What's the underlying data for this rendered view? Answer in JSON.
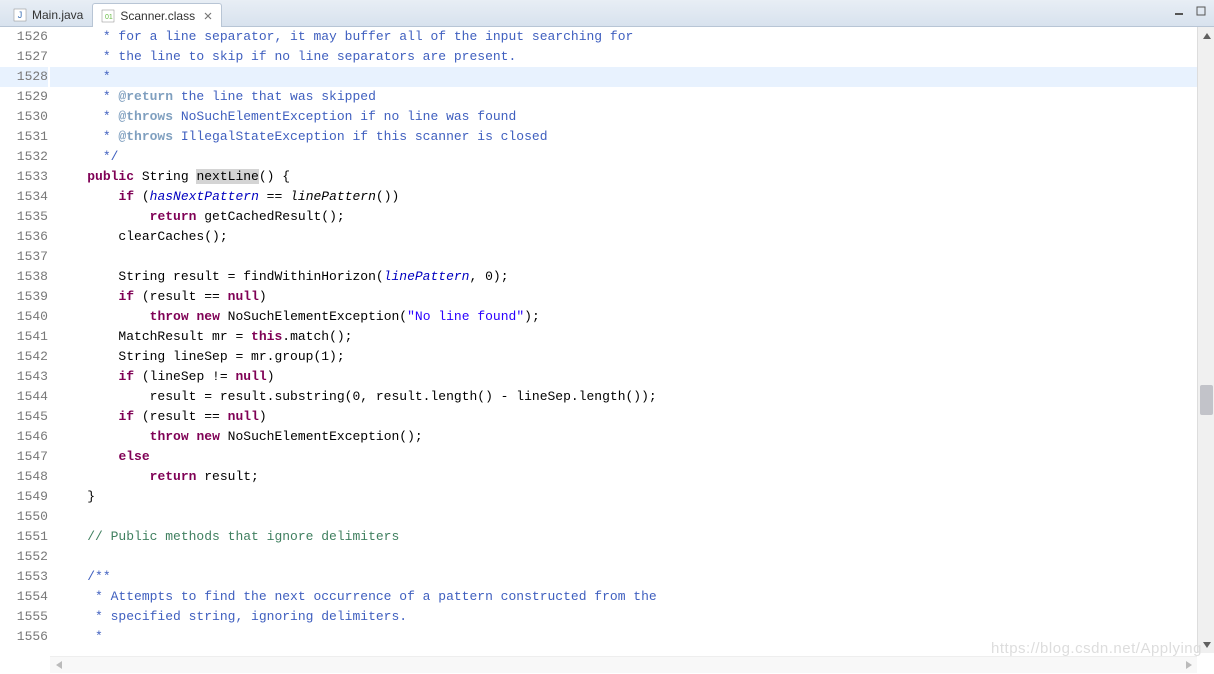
{
  "tabs": {
    "inactive": {
      "label": "Main.java"
    },
    "active": {
      "label": "Scanner.class"
    }
  },
  "gutter": {
    "start": 1526,
    "end": 1556
  },
  "highlightLine": 1528,
  "code": {
    "l1526": " * for a line separator, it may buffer all of the input searching for",
    "l1527": " * the line to skip if no line separators are present.",
    "l1528": " *",
    "l1529_prefix": " * ",
    "l1529_tag": "@return",
    "l1529_rest": " the line that was skipped",
    "l1530_prefix": " * ",
    "l1530_tag": "@throws",
    "l1530_rest": " NoSuchElementException if no line was found",
    "l1531_prefix": " * ",
    "l1531_tag": "@throws",
    "l1531_rest": " IllegalStateException if this scanner is closed",
    "l1532": " */",
    "l1533_kw": "public",
    "l1533_type": " String ",
    "l1533_name": "nextLine",
    "l1533_rest": "() {",
    "l1534_pre": "    ",
    "l1534_kw": "if",
    "l1534_mid": " (",
    "l1534_field": "hasNextPattern",
    "l1534_mid2": " == ",
    "l1534_call": "linePattern",
    "l1534_rest": "())",
    "l1535_pre": "        ",
    "l1535_kw": "return",
    "l1535_rest": " getCachedResult();",
    "l1536": "    clearCaches();",
    "l1538_pre": "    String result = findWithinHorizon(",
    "l1538_field": "linePattern",
    "l1538_rest": ", 0);",
    "l1539_pre": "    ",
    "l1539_kw": "if",
    "l1539_mid": " (result == ",
    "l1539_kw2": "null",
    "l1539_rest": ")",
    "l1540_pre": "        ",
    "l1540_kw1": "throw",
    "l1540_sp": " ",
    "l1540_kw2": "new",
    "l1540_mid": " NoSuchElementException(",
    "l1540_str": "\"No line found\"",
    "l1540_rest": ");",
    "l1541_pre": "    MatchResult mr = ",
    "l1541_kw": "this",
    "l1541_rest": ".match();",
    "l1542": "    String lineSep = mr.group(1);",
    "l1543_pre": "    ",
    "l1543_kw": "if",
    "l1543_mid": " (lineSep != ",
    "l1543_kw2": "null",
    "l1543_rest": ")",
    "l1544": "        result = result.substring(0, result.length() - lineSep.length());",
    "l1545_pre": "    ",
    "l1545_kw": "if",
    "l1545_mid": " (result == ",
    "l1545_kw2": "null",
    "l1545_rest": ")",
    "l1546_pre": "        ",
    "l1546_kw1": "throw",
    "l1546_sp": " ",
    "l1546_kw2": "new",
    "l1546_rest": " NoSuchElementException();",
    "l1547_pre": "    ",
    "l1547_kw": "else",
    "l1548_pre": "        ",
    "l1548_kw": "return",
    "l1548_rest": " result;",
    "l1549": "}",
    "l1551": "// Public methods that ignore delimiters",
    "l1553": "/**",
    "l1554": " * Attempts to find the next occurrence of a pattern constructed from the",
    "l1555": " * specified string, ignoring delimiters.",
    "l1556": " *"
  },
  "watermark": "https://blog.csdn.net/Applying"
}
